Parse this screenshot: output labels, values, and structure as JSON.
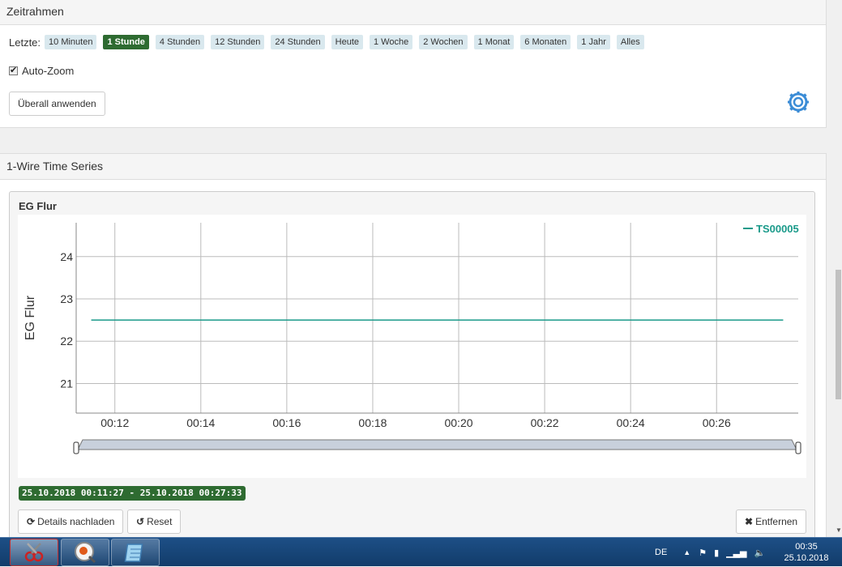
{
  "timeframe": {
    "heading": "Zeitrahmen",
    "last_label": "Letzte:",
    "ranges": [
      "10 Minuten",
      "1 Stunde",
      "4 Stunden",
      "12 Stunden",
      "24 Stunden",
      "Heute",
      "1 Woche",
      "2 Wochen",
      "1 Monat",
      "6 Monaten",
      "1 Jahr",
      "Alles"
    ],
    "active_range": "1 Stunde",
    "autozoom_label": "Auto-Zoom",
    "autozoom_checked": true,
    "apply_all_label": "Überall anwenden"
  },
  "series_panel": {
    "heading": "1-Wire Time Series",
    "chart_title": "EG Flur",
    "range_badge": "25.10.2018 00:11:27 - 25.10.2018 00:27:33",
    "reload_label": "Details nachladen",
    "reset_label": "Reset",
    "remove_label": "Entfernen"
  },
  "chart_data": {
    "type": "line",
    "title": "EG Flur",
    "xlabel": "",
    "ylabel": "EG Flur",
    "x_ticks": [
      "00:12",
      "00:14",
      "00:16",
      "00:18",
      "00:20",
      "00:22",
      "00:24",
      "00:26"
    ],
    "y_ticks": [
      21,
      22,
      23,
      24
    ],
    "ylim": [
      20.3,
      24.8
    ],
    "xlim": [
      "00:11:27",
      "00:27:33"
    ],
    "series": [
      {
        "name": "TS00005",
        "color": "#1a9a8a",
        "x": [
          "00:11:27",
          "00:27:33"
        ],
        "values": [
          22.5,
          22.5
        ]
      }
    ],
    "legend_position": "top-right",
    "grid": true
  },
  "taskbar": {
    "language": "DE",
    "time": "00:35",
    "date": "25.10.2018"
  },
  "colors": {
    "accent_green": "#2e6b31",
    "chip_bg": "#d9e8ee",
    "series": "#1a9a8a"
  }
}
